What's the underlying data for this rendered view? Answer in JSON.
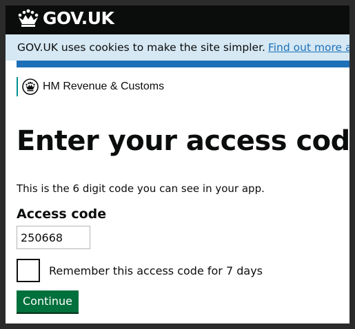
{
  "header": {
    "logo_text": "GOV.UK",
    "logo_icon": "crown-icon",
    "background": "#0b0c0c"
  },
  "cookie_banner": {
    "text": "GOV.UK uses cookies to make the site simpler.",
    "link_text": "Find out more about cookies",
    "background": "#d5e8f3",
    "link_color": "#1d70b8"
  },
  "department": {
    "name": "HM Revenue & Customs",
    "icon": "royal-crest-icon",
    "stripe_color": "#009390"
  },
  "main": {
    "title": "Enter your access code",
    "hint": "This is the 6 digit code you can see in your app.",
    "field_label": "Access code",
    "field_value": "250668",
    "checkbox_label": "Remember this access code for 7 days",
    "checkbox_checked": false,
    "button_label": "Continue",
    "button_color": "#00703c"
  }
}
